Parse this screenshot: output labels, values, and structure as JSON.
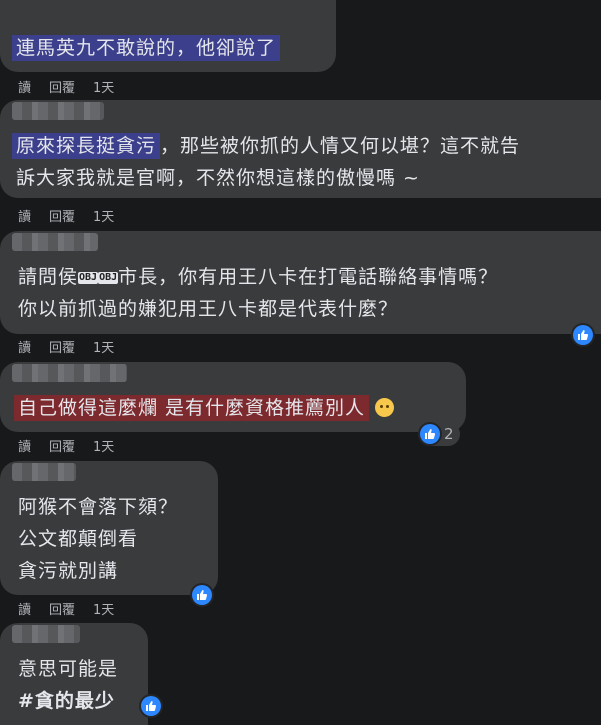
{
  "actions": {
    "read": "讀",
    "reply": "回覆"
  },
  "colors": {
    "like_blue": "#2d88ff",
    "bubble": "#3a3b3c",
    "text": "#e4e6eb"
  },
  "comments": [
    {
      "text_highlight": "連馬英九不敢說的，他卻說了",
      "time": "1天"
    },
    {
      "text_highlight": "原來探長挺貪污",
      "text_rest_line1": "，那些被你抓的人情又何以堪？這不就告",
      "text_line2": "訴大家我就是官啊，不然你想這樣的傲慢嗎 ~",
      "time": "1天"
    },
    {
      "text_line1_a": "請問侯",
      "censor": [
        "OBJ",
        "OBJ"
      ],
      "text_line1_b": "市長，你有用王八卡在打電話聯絡事情嗎？",
      "text_line2": "你以前抓過的嫌犯用王八卡都是代表什麼？",
      "time": "1天",
      "reaction_icon": "like-icon"
    },
    {
      "text_highlight": "自己做得這麼爛 是有什麼資格推薦別人",
      "emoji": "sad-face-emoji",
      "time": "1天",
      "reaction_icon": "like-icon",
      "reaction_count": "2"
    },
    {
      "lines": [
        "阿猴不會落下頦？",
        "公文都顛倒看",
        "貪污就別講"
      ],
      "time": "1天",
      "reaction_icon": "like-icon"
    },
    {
      "lines": [
        "意思可能是",
        "#貪的最少"
      ],
      "reaction_icon": "like-icon"
    }
  ]
}
